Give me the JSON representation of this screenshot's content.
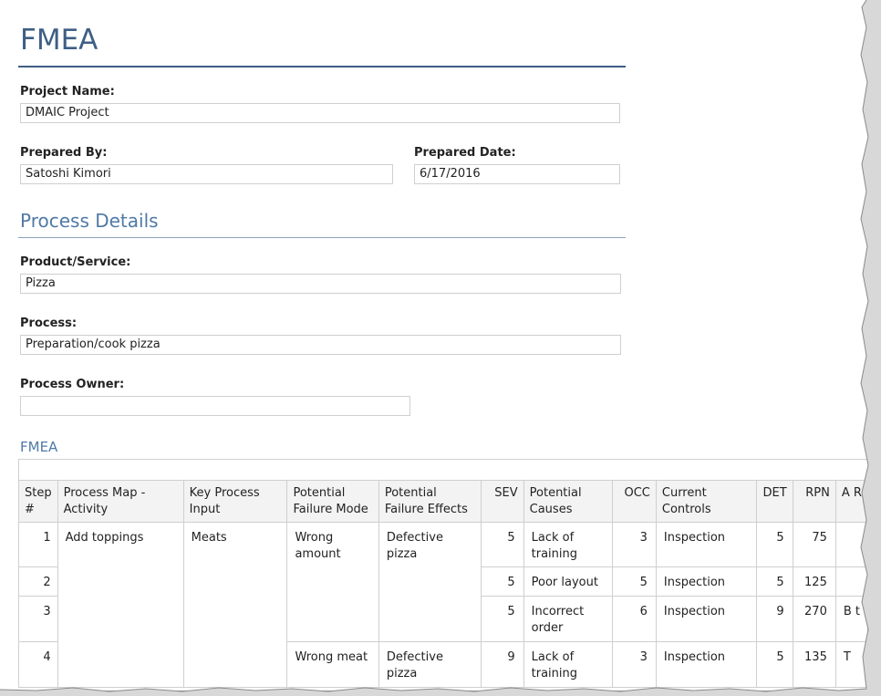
{
  "title": "FMEA",
  "project": {
    "name_label": "Project Name:",
    "name_value": "DMAIC Project",
    "prepared_by_label": "Prepared By:",
    "prepared_by_value": "Satoshi Kimori",
    "prepared_date_label": "Prepared Date:",
    "prepared_date_value": "6/17/2016"
  },
  "process_details": {
    "heading": "Process Details",
    "product_label": "Product/Service:",
    "product_value": "Pizza",
    "process_label": "Process:",
    "process_value": "Preparation/cook pizza",
    "owner_label": "Process Owner:",
    "owner_value": ""
  },
  "fmea_table": {
    "heading": "FMEA",
    "columns": {
      "step": "Step #",
      "activity": "Process Map - Activity",
      "input": "Key Process Input",
      "failure_mode": "Potential Failure Mode",
      "failure_effects": "Potential Failure Effects",
      "sev": "SEV",
      "causes": "Potential Causes",
      "occ": "OCC",
      "controls": "Current Controls",
      "det": "DET",
      "rpn": "RPN",
      "partial": "A R"
    },
    "groups": {
      "activity": "Add toppings",
      "input": "Meats",
      "mode_1": "Wrong amount",
      "effects_1": "Defective pizza",
      "mode_2": "Wrong meat",
      "effects_2": "Defective pizza"
    },
    "rows": [
      {
        "step": "1",
        "sev": "5",
        "cause": "Lack of training",
        "occ": "3",
        "control": "Inspection",
        "det": "5",
        "rpn": "75",
        "partial": ""
      },
      {
        "step": "2",
        "sev": "5",
        "cause": "Poor layout",
        "occ": "5",
        "control": "Inspection",
        "det": "5",
        "rpn": "125",
        "partial": ""
      },
      {
        "step": "3",
        "sev": "5",
        "cause": "Incorrect order",
        "occ": "6",
        "control": "Inspection",
        "det": "9",
        "rpn": "270",
        "partial": "B t"
      },
      {
        "step": "4",
        "sev": "9",
        "cause": "Lack of training",
        "occ": "3",
        "control": "Inspection",
        "det": "5",
        "rpn": "135",
        "partial": "T"
      }
    ]
  },
  "colors": {
    "heading": "#3e5f85",
    "subheading": "#4f7aa6",
    "header_bg": "#f3f3f3",
    "border": "#cfcfcf"
  }
}
